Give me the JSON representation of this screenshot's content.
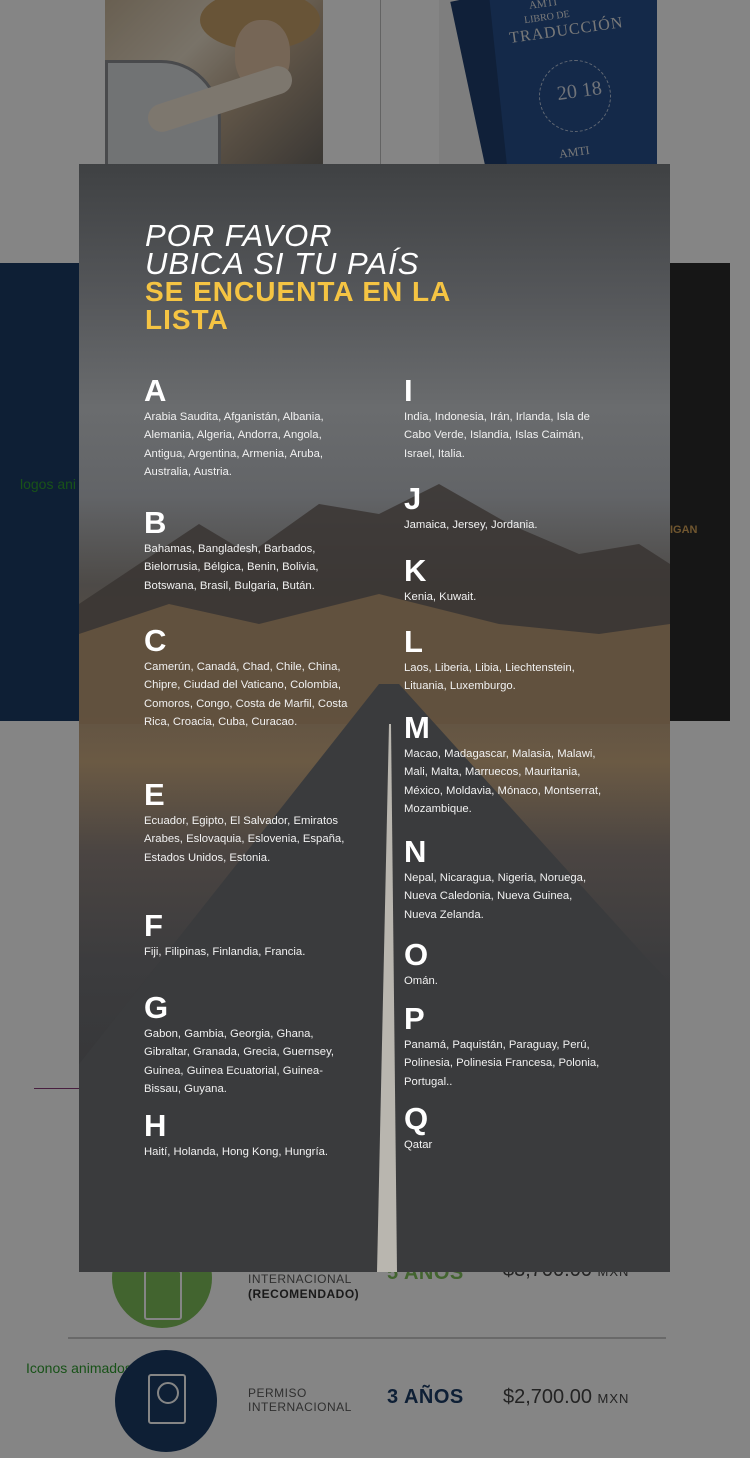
{
  "background": {
    "logos_label": "logos ani",
    "iconos_label": "Iconos animados",
    "book": {
      "top_brand": "AMTI",
      "title_small": "LIBRO DE",
      "title": "TRADUCCIÓN",
      "year": "20 18",
      "brand": "AMTI"
    },
    "right_sign": "IGAN",
    "rows": [
      {
        "line1": "INTERNACIONAL",
        "line2": "(RECOMENDADO)",
        "years": "5 AÑOS",
        "price": "$3,700.00",
        "currency": "MXN"
      },
      {
        "line1": "PERMISO",
        "line2": "INTERNACIONAL",
        "years": "3 AÑOS",
        "price": "$2,700.00",
        "currency": "MXN"
      }
    ]
  },
  "modal": {
    "title": {
      "line1": "POR FAVOR",
      "line2": "UBICA SI TU PAÍS",
      "line3": "SE ENCUENTA EN LA",
      "line4": "LISTA"
    },
    "left": [
      {
        "letter": "A",
        "countries": "Arabia Saudita, Afganistán, Albania, Alemania, Algeria, Andorra, Angola, Antigua, Argentina, Armenia, Aruba, Australia, Austria."
      },
      {
        "letter": "B",
        "countries": "Bahamas, Bangladesh, Barbados, Bielorrusia, Bélgica, Benin, Bolivia, Botswana, Brasil, Bulgaria, Bután."
      },
      {
        "letter": "C",
        "countries": "Camerún, Canadá, Chad, Chile, China, Chipre, Ciudad del Vaticano, Colombia, Comoros, Congo, Costa de Marfil, Costa Rica, Croacia, Cuba, Curacao."
      },
      {
        "letter": "E",
        "countries": "Ecuador, Egipto, El Salvador, Emiratos Arabes, Eslovaquia, Eslovenia, España, Estados Unidos, Estonia."
      },
      {
        "letter": "F",
        "countries": "Fiji, Filipinas, Finlandia, Francia."
      },
      {
        "letter": "G",
        "countries": "Gabon, Gambia, Georgia, Ghana, Gibraltar, Granada, Grecia, Guernsey, Guinea, Guinea Ecuatorial, Guinea-Bissau, Guyana."
      },
      {
        "letter": "H",
        "countries": "Haití, Holanda, Hong Kong, Hungría."
      }
    ],
    "right": [
      {
        "letter": "I",
        "countries": "India, Indonesia, Irán, Irlanda, Isla de Cabo Verde, Islandia, Islas Caimán, Israel, Italia."
      },
      {
        "letter": "J",
        "countries": "Jamaica, Jersey, Jordania."
      },
      {
        "letter": "K",
        "countries": "Kenia, Kuwait."
      },
      {
        "letter": "L",
        "countries": "Laos, Liberia, Libia, Liechtenstein, Lituania, Luxemburgo."
      },
      {
        "letter": "M",
        "countries": "Macao, Madagascar, Malasia, Malawi, Mali, Malta, Marruecos, Mauritania, México, Moldavia, Mónaco, Montserrat, Mozambique."
      },
      {
        "letter": "N",
        "countries": "Nepal, Nicaragua, Nigeria, Noruega, Nueva Caledonia, Nueva Guinea, Nueva Zelanda."
      },
      {
        "letter": "O",
        "countries": "Omán."
      },
      {
        "letter": "P",
        "countries": "Panamá, Paquistán, Paraguay, Perú, Polinesia, Polinesia Francesa, Polonia, Portugal.."
      },
      {
        "letter": "Q",
        "countries": "Qatar"
      }
    ]
  }
}
